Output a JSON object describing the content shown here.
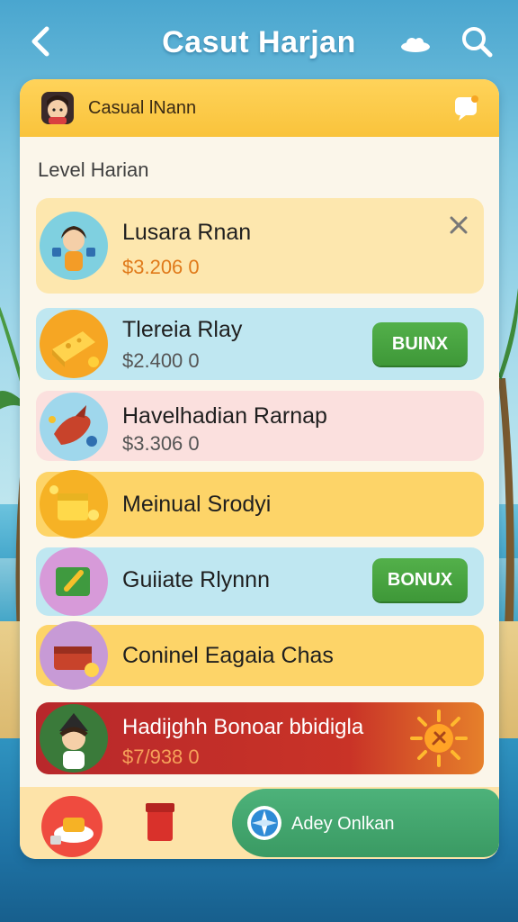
{
  "header": {
    "title": "Casut Harjan",
    "back_icon": "chevron-left-icon",
    "weather_icon": "cloud-icon",
    "search_icon": "search-icon"
  },
  "card": {
    "header_title": "Casual lNann",
    "section_title": "Level Harian",
    "rows": [
      {
        "name": "Lusara Rnan",
        "price": "$3.206  0",
        "icon": "girl-avatar-icon",
        "action": "close"
      },
      {
        "name": "Tlereia Rlay",
        "price": "$2.400  0",
        "icon": "cheese-block-icon",
        "button": "BUINX"
      },
      {
        "name": "Havelhadian Rarnap",
        "price": "$3.306  0",
        "icon": "red-dragon-icon"
      },
      {
        "name": "Meinual Srodyi",
        "icon": "gold-boxes-icon"
      },
      {
        "name": "Guiiate Rlynnn",
        "icon": "green-card-icon",
        "button": "BONUX"
      },
      {
        "name": "Coninel Eagaia Chas",
        "icon": "treasure-chest-icon"
      },
      {
        "name": "Hadijghh Bonoar bbidigla",
        "price": "$7/938  0",
        "icon": "girl-hat-avatar-icon"
      }
    ]
  },
  "bottom": {
    "home_icon": "food-plate-icon",
    "box_icon": "red-box-icon",
    "apply_label": "Adey Onlkan",
    "apply_icon": "compass-icon"
  },
  "colors": {
    "header_yellow": "#F9C33B",
    "price_orange": "#E07A1A",
    "price_grey": "#555555",
    "button_green": "#3E9838",
    "highlight_red": "#B8282B",
    "apply_green": "#3A9A63"
  }
}
